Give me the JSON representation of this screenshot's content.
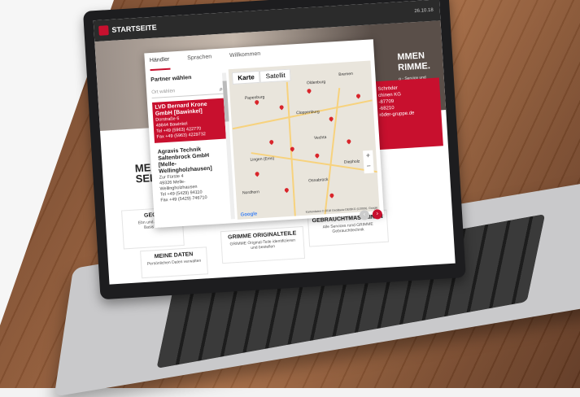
{
  "site": {
    "bar_title": "STARTSEITE",
    "date": "26.10.18",
    "hero_text": "MMEN\nRIMME.",
    "hero_sub": "g - Service und",
    "left_title": "MEI\nSERV",
    "red_box": {
      "lines": [
        "Schröder",
        "chinen KG",
        "",
        "-87709",
        "-68210",
        "röder-gruppe.de"
      ]
    },
    "cards": [
      {
        "title": "GEOF",
        "text": "Ebn und Ausme\nBasis von"
      },
      {
        "title": "MEINE DATEN",
        "text": "Persönlichen Daten verwalten"
      },
      {
        "title": "GRIMME ORIGINALTEILE",
        "text": "GRIMME Original-Teile identifizieren\nund bestellen"
      },
      {
        "title": "GEBRAUCHTMASCHINEN",
        "text": "Alle Services rund GRIMME\nGebrauchttechnik"
      }
    ]
  },
  "modal": {
    "tabs": [
      "Händler",
      "Sprachen",
      "Willkommen"
    ],
    "partner_title": "Partner wählen",
    "search_placeholder": "Ort wählen",
    "dealers": [
      {
        "name": "LVD Bernard Krone GmbH [Bawinkel]",
        "lines": [
          "Dorstraße 6",
          "49844 Bawinkel",
          "Tel +49 (5963) 422770",
          "Fax +49 (5963) 4229732"
        ],
        "selected": true
      },
      {
        "name": "Agravis Technik Saltenbrock GmbH [Melle-Wellingholzhausen]",
        "lines": [
          "Zur Fürste 4",
          "49326 Melle-",
          "Wellingholzhausen",
          "Tel +49 (5429) 94110",
          "Fax +49 (5429) 746710"
        ],
        "selected": false
      }
    ],
    "map": {
      "buttons": [
        "Karte",
        "Satellit"
      ],
      "cities": [
        "Oldenburg",
        "Bremen",
        "Papenburg",
        "Cloppenburg",
        "Vechta",
        "Osnabrück",
        "Diepholz",
        "Lingen (Ems)",
        "Nordhorn"
      ],
      "google": "Google",
      "attribution": "Kartendaten © 2018 GeoBasis-DE/BKG (©2009), Google"
    }
  },
  "colors": {
    "accent": "#c8102e",
    "map_bg": "#e9e5dc"
  }
}
